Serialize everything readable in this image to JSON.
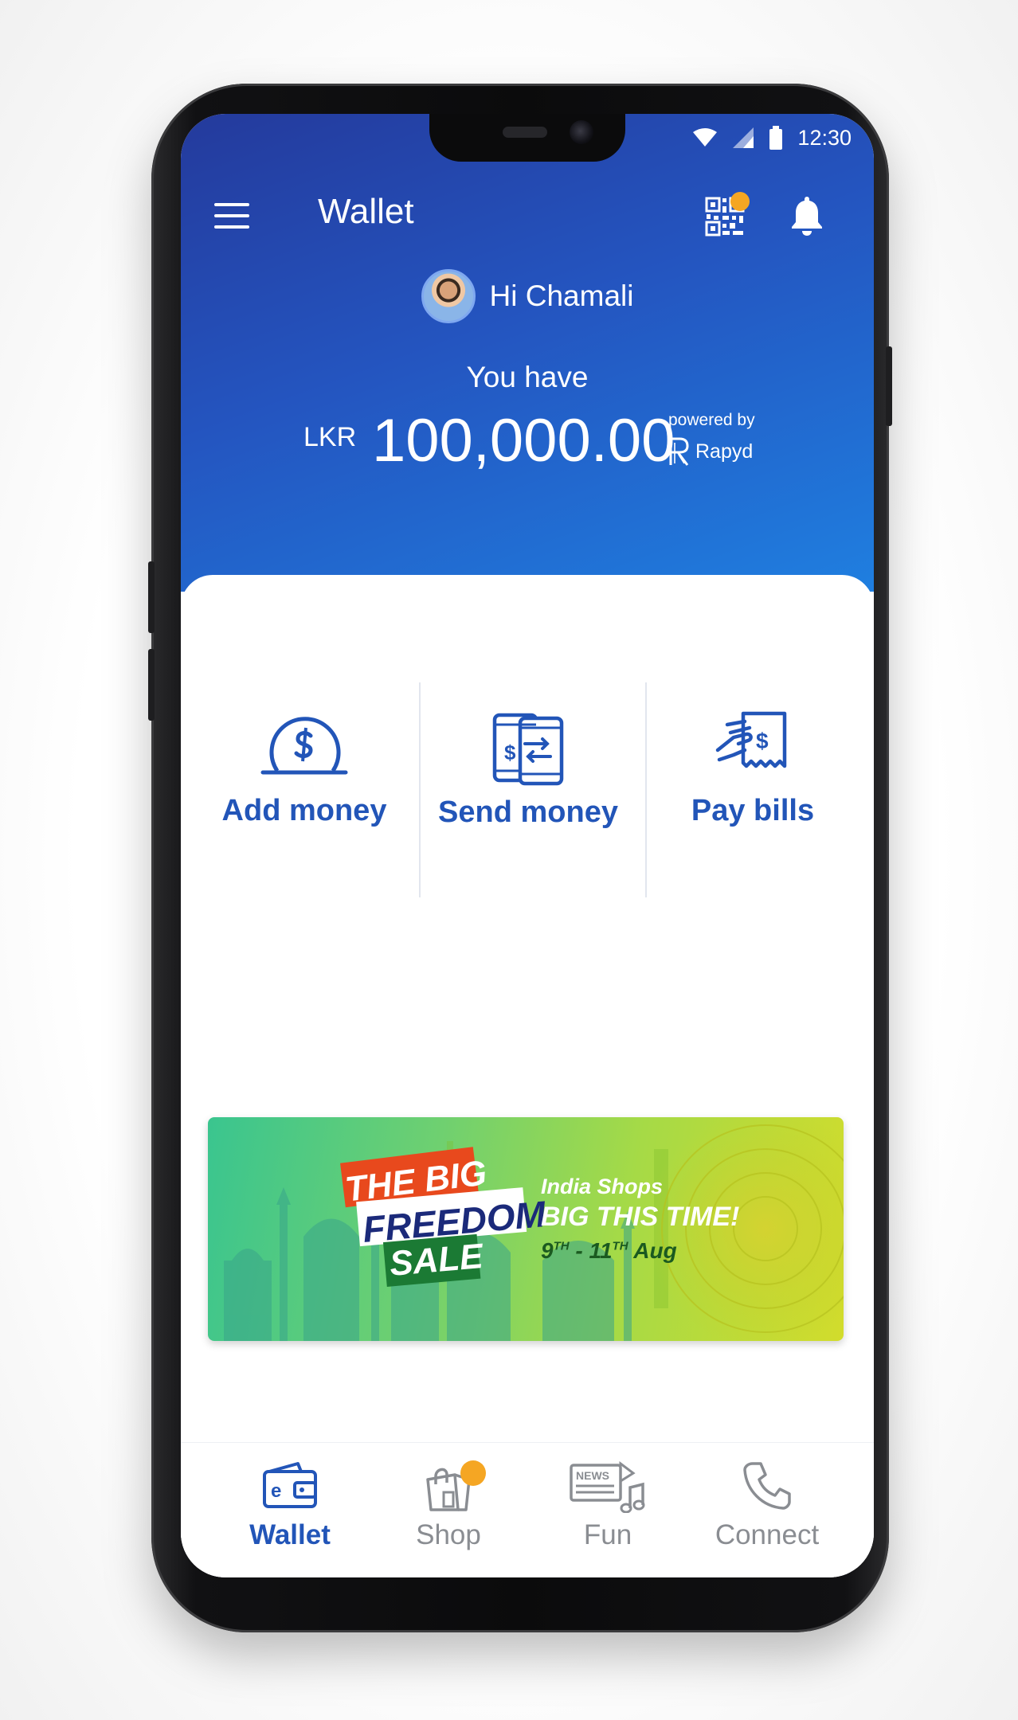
{
  "status_bar": {
    "time": "12:30",
    "icons": [
      "wifi-icon",
      "signal-icon",
      "battery-icon"
    ]
  },
  "header": {
    "title": "Wallet",
    "menu_icon": "hamburger-menu-icon",
    "qr_icon": "qr-code-icon",
    "bell_icon": "bell-icon",
    "qr_badge_color": "#f5a623"
  },
  "greeting": {
    "text": "Hi Chamali"
  },
  "balance": {
    "label": "You have",
    "currency": "LKR",
    "amount": "100,000.00",
    "powered_by": "powered by",
    "provider": "Rapyd"
  },
  "actions": [
    {
      "label": "Add money",
      "icon": "coin-slot-icon"
    },
    {
      "label": "Send money",
      "icon": "phone-transfer-icon"
    },
    {
      "label": "Pay bills",
      "icon": "hand-bill-icon"
    }
  ],
  "banner": {
    "line1": "THE BIG",
    "line2": "FREEDOM",
    "line3": "SALE",
    "tagline1": "India Shops",
    "tagline2": "BIG THIS TIME!",
    "date_start_day": "9",
    "date_start_sup": "TH",
    "date_sep": " - ",
    "date_end_day": "11",
    "date_end_sup": "TH",
    "date_month": " Aug"
  },
  "bottom_nav": [
    {
      "label": "Wallet",
      "icon": "wallet-icon",
      "active": true
    },
    {
      "label": "Shop",
      "icon": "shopping-bag-icon",
      "active": false
    },
    {
      "label": "Fun",
      "icon": "news-music-icon",
      "active": false
    },
    {
      "label": "Connect",
      "icon": "phone-icon",
      "active": false
    }
  ],
  "colors": {
    "accent": "#2255b8",
    "badge": "#f5a623",
    "hero_start": "#243a9c",
    "hero_end": "#1f7fe0"
  }
}
